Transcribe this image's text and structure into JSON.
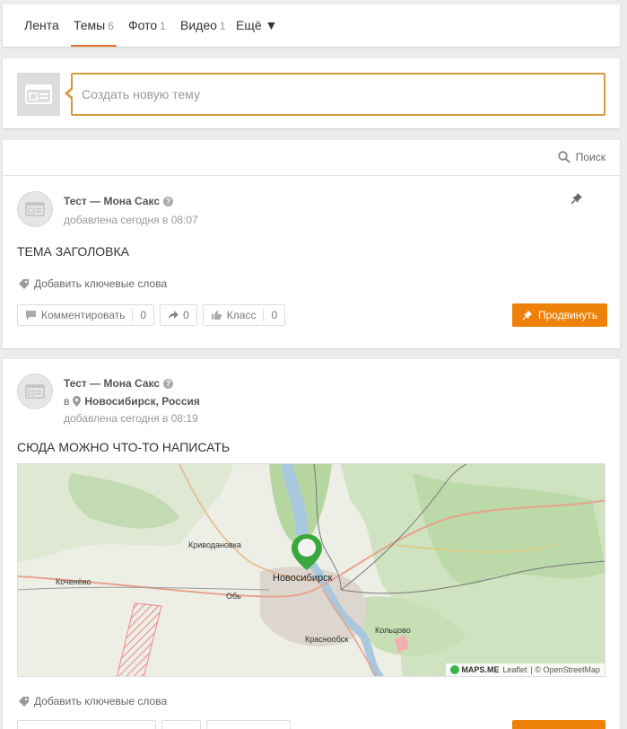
{
  "tabs": [
    {
      "label": "Лента",
      "count": ""
    },
    {
      "label": "Темы",
      "count": "6"
    },
    {
      "label": "Фото",
      "count": "1"
    },
    {
      "label": "Видео",
      "count": "1"
    },
    {
      "label": "Ещё ▼",
      "count": ""
    }
  ],
  "new_topic": {
    "placeholder": "Создать новую тему"
  },
  "search": {
    "label": "Поиск"
  },
  "posts": [
    {
      "author": "Тест — Мона Сакс",
      "date": "добавлена сегодня в 08:07",
      "title": "ТЕМА ЗАГОЛОВКА",
      "keywords": "Добавить ключевые слова",
      "comment_label": "Комментировать",
      "comment_count": "0",
      "share_count": "0",
      "like_label": "Класс",
      "like_count": "0",
      "promote": "Продвинуть"
    },
    {
      "author": "Тест — Мона Сакс",
      "location_prefix": "в",
      "location": "Новосибирск, Россия",
      "date": "добавлена сегодня в 08:19",
      "title": "СЮДА МОЖНО ЧТО-ТО НАПИСАТЬ",
      "keywords": "Добавить ключевые слова"
    }
  ],
  "map": {
    "labels": [
      "Криводановка",
      "Новосибирск",
      "Коченёво",
      "Обь",
      "Краснообск",
      "Кольцово"
    ],
    "attribution_brand": "MAPS.ME",
    "attribution_leaflet": "Leaflet",
    "attribution_osm": "| © OpenStreetMap"
  },
  "colors": {
    "accent": "#ee8208",
    "tab_underline": "#eb722e",
    "pin": "#3aa83c"
  }
}
